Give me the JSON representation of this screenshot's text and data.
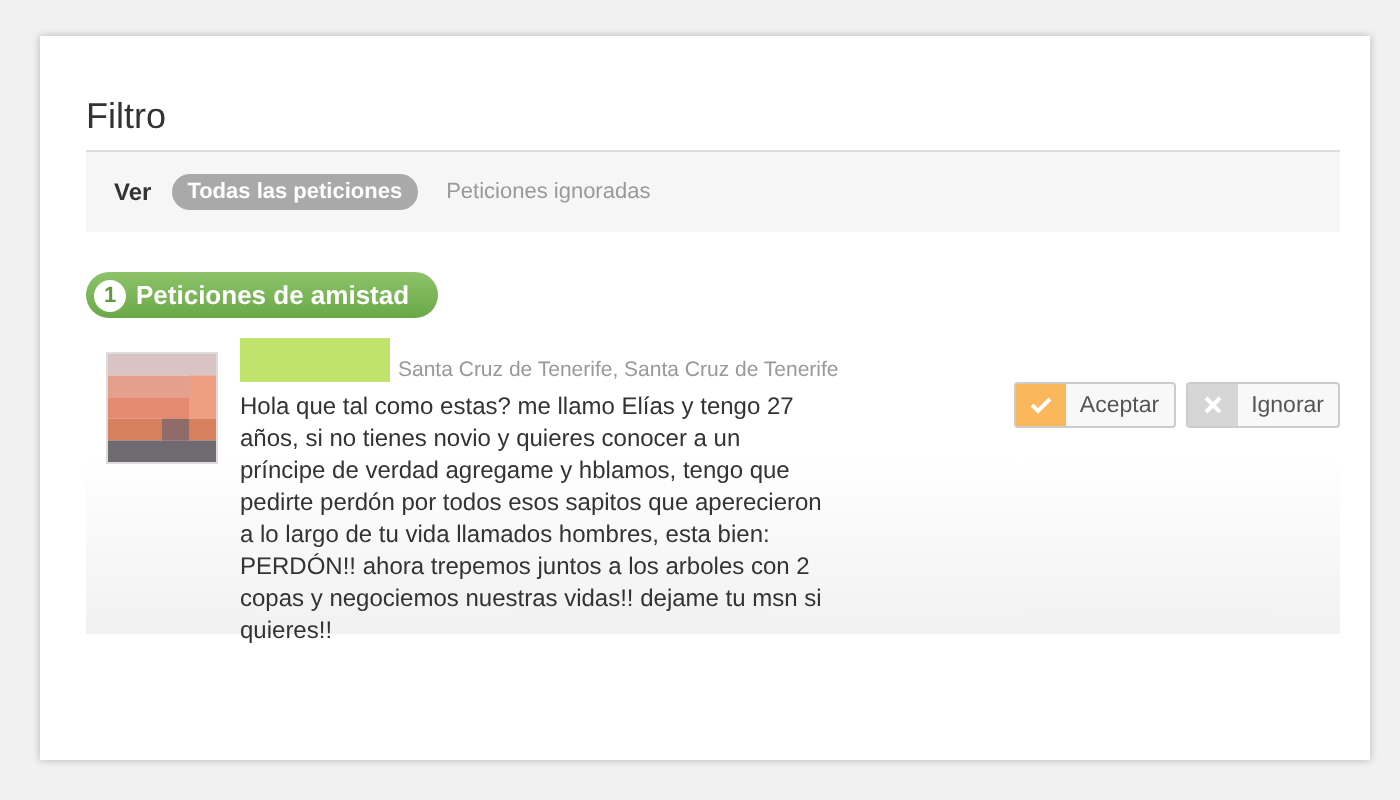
{
  "heading": "Filtro",
  "filter": {
    "label": "Ver",
    "options": [
      {
        "label": "Todas las peticiones",
        "selected": true
      },
      {
        "label": "Peticiones ignoradas",
        "selected": false
      }
    ]
  },
  "section": {
    "count": "1",
    "title": "Peticiones de amistad"
  },
  "requests": [
    {
      "location": "Santa Cruz de Tenerife, Santa Cruz de Tenerife",
      "message": "Hola que tal como estas? me llamo Elías y tengo 27 años, si no tienes novio y quieres conocer a un príncipe de verdad agregame y hblamos, tengo que pedirte perdón por todos esos sapitos que aperecieron a lo largo de tu vida llamados hombres, esta bien: PERDÓN!! ahora trepemos juntos a los arboles con 2 copas y negociemos nuestras vidas!! dejame tu msn si quieres!!",
      "accept": "Aceptar",
      "ignore": "Ignorar"
    }
  ]
}
